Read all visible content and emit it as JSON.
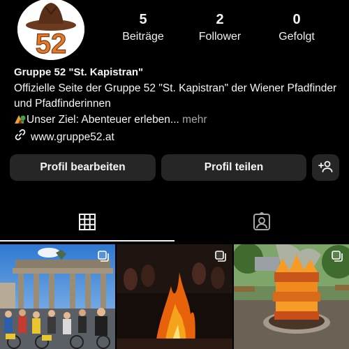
{
  "profile": {
    "logo_text": "52",
    "name": "Gruppe 52 \"St. Kapistran\"",
    "bio": "Offizielle Seite der Gruppe 52 \"St. Kapistran\" der Wiener Pfadfinder und Pfadfinderinnen",
    "goal": "Unser Ziel: Abenteuer erleben...",
    "more": " mehr",
    "website": "www.gruppe52.at"
  },
  "stats": [
    {
      "value": "5",
      "label": "Beiträge"
    },
    {
      "value": "2",
      "label": "Follower"
    },
    {
      "value": "0",
      "label": "Gefolgt"
    }
  ],
  "actions": {
    "edit_profile": "Profil bearbeiten",
    "share_profile": "Profil teilen"
  },
  "tabs": {
    "active": "posts-grid"
  },
  "posts": [
    {
      "subject": "Brandenburg Gate with cyclists"
    },
    {
      "subject": "Campfire at night"
    },
    {
      "subject": "Large bonfire stack"
    }
  ]
}
